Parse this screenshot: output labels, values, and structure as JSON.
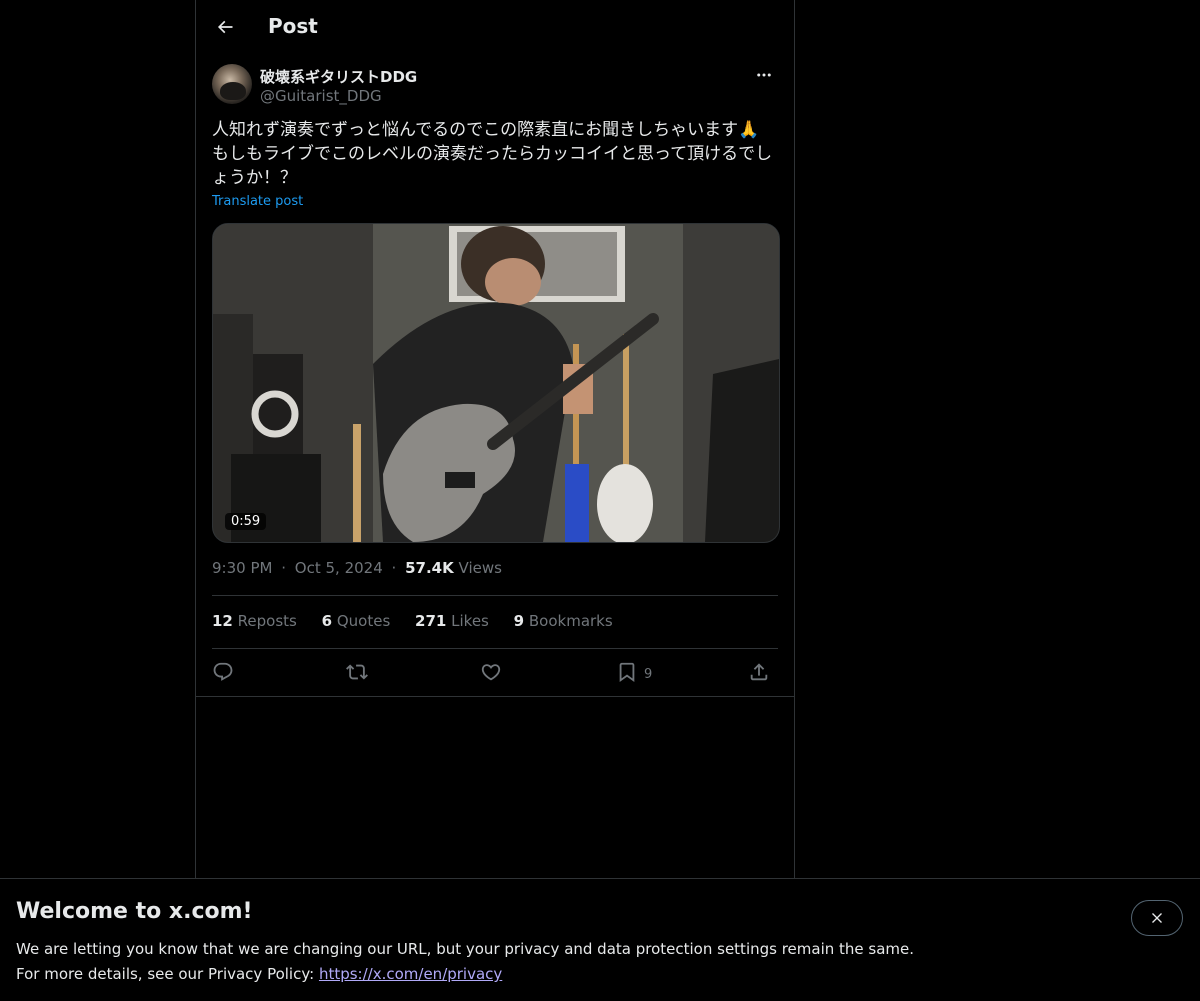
{
  "header": {
    "title": "Post"
  },
  "post": {
    "author": {
      "display_name": "破壊系ギタリストDDG",
      "handle": "@Guitarist_DDG"
    },
    "text": "人知れず演奏でずっと悩んでるのでこの際素直にお聞きしちゃいます🙏\nもしもライブでこのレベルの演奏だったらカッコイイと思って頂けるでしょうか！？",
    "translate_label": "Translate post",
    "media": {
      "duration": "0:59"
    },
    "time": "9:30 PM",
    "date": "Oct 5, 2024",
    "separator": "·",
    "views_count": "57.4K",
    "views_label": "Views"
  },
  "stats": {
    "reposts": {
      "count": "12",
      "label": "Reposts"
    },
    "quotes": {
      "count": "6",
      "label": "Quotes"
    },
    "likes": {
      "count": "271",
      "label": "Likes"
    },
    "bookmarks": {
      "count": "9",
      "label": "Bookmarks"
    }
  },
  "actions": {
    "reply_icon": "reply-icon",
    "repost_icon": "repost-icon",
    "like_icon": "heart-icon",
    "bookmark_icon": "bookmark-icon",
    "bookmark_count": "9",
    "share_icon": "share-icon"
  },
  "banner": {
    "title": "Welcome to x.com!",
    "line1": "We are letting you know that we are changing our URL, but your privacy and data protection settings remain the same.",
    "line2_prefix": "For more details, see our Privacy Policy: ",
    "link": "https://x.com/en/privacy"
  },
  "colors": {
    "background": "#000000",
    "text_primary": "#e7e9ea",
    "text_secondary": "#71767b",
    "link": "#1d9bf0",
    "border": "#2f3336"
  }
}
